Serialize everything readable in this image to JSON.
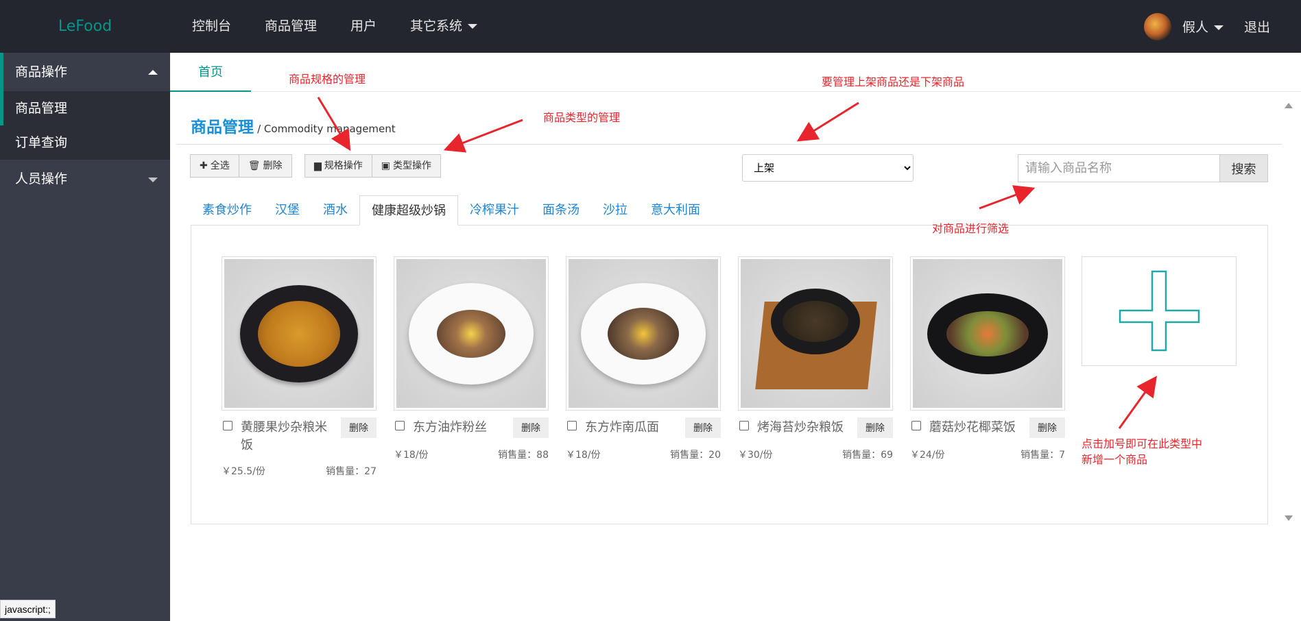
{
  "app": {
    "logo": "LeFood"
  },
  "topnav": {
    "items": [
      "控制台",
      "商品管理",
      "用户",
      "其它系统"
    ],
    "user_name": "假人",
    "logout": "退出"
  },
  "sidebar": {
    "group1": {
      "label": "商品操作",
      "items": [
        "商品管理",
        "订单查询"
      ]
    },
    "group2": {
      "label": "人员操作"
    }
  },
  "tabs": {
    "home": "首页"
  },
  "page": {
    "title": "商品管理",
    "subtitle": "/ Commodity management"
  },
  "toolbar": {
    "select_all": "全选",
    "delete": "删除",
    "spec_ops": "规格操作",
    "type_ops": "类型操作"
  },
  "filter": {
    "status_selected": "上架"
  },
  "search": {
    "placeholder": "请输入商品名称",
    "button": "搜索"
  },
  "type_tabs": [
    "素食炒作",
    "汉堡",
    "酒水",
    "健康超级炒锅",
    "冷榨果汁",
    "面条汤",
    "沙拉",
    "意大利面"
  ],
  "products": [
    {
      "name": "黄腰果炒杂粮米饭",
      "price": "￥25.5/份",
      "sales": "销售量：27",
      "delete": "删除"
    },
    {
      "name": "东方油炸粉丝",
      "price": "￥18/份",
      "sales": "销售量：88",
      "delete": "删除"
    },
    {
      "name": "东方炸南瓜面",
      "price": "￥18/份",
      "sales": "销售量：20",
      "delete": "删除"
    },
    {
      "name": "烤海苔炒杂粮饭",
      "price": "￥30/份",
      "sales": "销售量：69",
      "delete": "删除"
    },
    {
      "name": "蘑菇炒花椰菜饭",
      "price": "￥24/份",
      "sales": "销售量：7",
      "delete": "删除"
    }
  ],
  "annotations": {
    "spec": "商品规格的管理",
    "type": "商品类型的管理",
    "status": "要管理上架商品还是下架商品",
    "filter": "对商品进行筛选",
    "add_line1": "点击加号即可在此类型中",
    "add_line2": "新增一个商品"
  },
  "statusbar": "javascript:;",
  "colors": {
    "accent": "#009688",
    "link": "#1f84d3",
    "annotation": "#e8242c",
    "header_bg": "#23262e",
    "sidebar_bg": "#393d49"
  }
}
